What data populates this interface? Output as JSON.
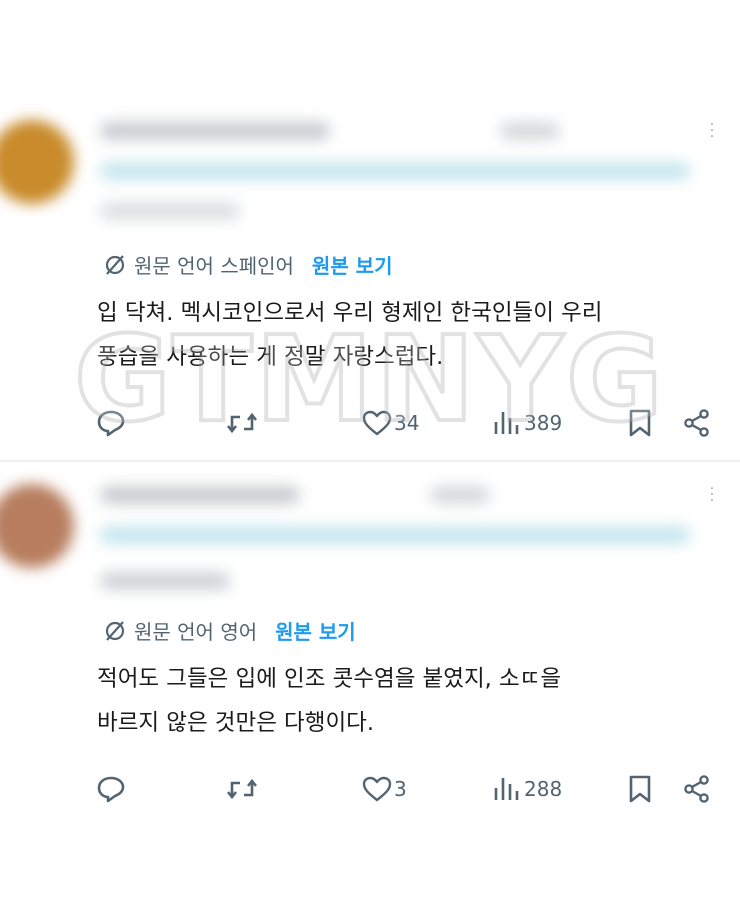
{
  "posts": [
    {
      "translation_notice": "원문 언어 스페인어",
      "view_original": "원본 보기",
      "body_lines": [
        "입 닥쳐. 멕시코인으로서 우리 형제인 한국인들이 우리",
        "풍습을 사용하는 게 정말 자랑스럽다."
      ],
      "likes": "34",
      "views": "389"
    },
    {
      "translation_notice": "원문 언어 영어",
      "view_original": "원본 보기",
      "body_lines": [
        "적어도 그들은 입에 인조 콧수염을 붙였지, 소ㄸ을",
        "바르지 않은 것만은 다행이다."
      ],
      "likes": "3",
      "views": "288"
    }
  ],
  "watermark": "GTMNYG",
  "icons": {
    "translate": "translate-icon",
    "reply": "reply-icon",
    "repost": "repost-icon",
    "like": "heart-icon",
    "views": "views-icon",
    "bookmark": "bookmark-icon",
    "share": "share-icon"
  },
  "colors": {
    "accent": "#1d9bf0",
    "muted": "#536471",
    "avatar1": "#c98b2b",
    "avatar2": "#b77d5e"
  }
}
